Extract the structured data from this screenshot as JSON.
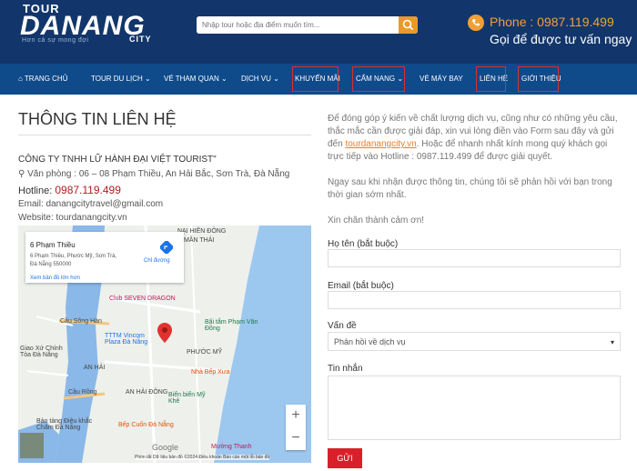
{
  "header": {
    "logo_tour": "TOUR",
    "logo_main": "DANANG",
    "logo_tagline": "Hơn cả sự mong đợi",
    "logo_city": "CITY",
    "search_placeholder": "Nhập tour hoặc địa điểm muốn tìm...",
    "phone_label": "Phone : 0987.119.499",
    "phone_sub": "Gọi để được tư vấn ngay"
  },
  "nav": {
    "items": [
      "TRANG CHỦ",
      "TOUR DU LỊCH",
      "VÉ THAM QUAN",
      "DỊCH VỤ",
      "KHUYẾN MÃI",
      "CẨM NANG",
      "VÉ MÁY BAY",
      "LIÊN HỆ",
      "GIỚI THIỆU"
    ]
  },
  "contact": {
    "title": "THÔNG TIN LIÊN HỆ",
    "company": "CÔNG TY TNHH LỮ HÀNH ĐẠI VIỆT TOURIST\"",
    "office": "Văn phòng : 06 – 08 Phạm Thiều, An Hải Bắc, Sơn Trà, Đà Nẵng",
    "hotline_label": "Hotline:",
    "hotline_number": "0987.119.499",
    "email": "Email: danangcitytravel@gmail.com",
    "website": "Website: tourdanangcity.vn"
  },
  "map": {
    "info_title": "6 Phạm Thiều",
    "info_address": "6 Phạm Thiều, Phước Mỹ, Sơn Trà, Đà Nẵng 550000",
    "directions": "Chỉ đường",
    "view_larger": "Xem bản đồ lớn hơn",
    "labels": [
      "NẠI HIÊN ĐÔNG",
      "MÂN THÁI",
      "Club SEVEN DRAGON",
      "Bãi tắm Phạm Văn Đồng",
      "Cầu Sông Hàn",
      "TTTM Vincom Plaza Đà Nẵng",
      "Giao Xứ Chính Tòa Đà Nẵng",
      "PHƯỚC MỸ",
      "AN HẢI",
      "Nhà Bếp Xưa",
      "AN HẢI ĐÔNG",
      "Cầu Rồng",
      "Biển biển Mỹ Khê",
      "Bảo tàng Điêu khắc Chăm Đà Nẵng",
      "Bếp Cuốn Đà Nẵng",
      "Mường Thanh",
      "Google"
    ],
    "attribution": "Phím tắt   Dữ liệu bản đồ ©2024   Điều khoản   Báo cáo một lỗi bản đồ",
    "zoom_in": "+",
    "zoom_out": "−"
  },
  "form": {
    "intro": "Để đóng góp ý kiến về chất lượng dịch vụ, cũng như có những yêu cầu, thắc mắc cần được giải đáp, xin vui lòng điền vào Form sau đây và gửi đến",
    "intro_link": "tourdanangcity.vn",
    "intro_tail": ". Hoặc để nhanh nhất kính mong quý khách gọi trực tiếp vào Hotline : 0987.119.499 để được giải quyết.",
    "para2": "Ngay sau khi nhận được thông tin, chúng tôi sẽ phản hồi với bạn trong thời gian sớm nhất.",
    "para3": "Xin chân thành cảm ơn!",
    "name_label": "Họ tên (bắt buộc)",
    "email_label": "Email (bắt buộc)",
    "subject_label": "Vấn đề",
    "subject_value": "Phản hồi về dịch vụ",
    "message_label": "Tin nhắn",
    "submit": "GỬI"
  }
}
